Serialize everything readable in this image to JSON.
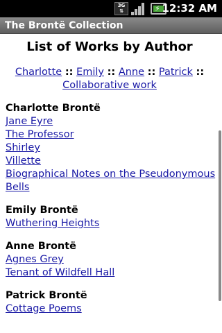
{
  "status_bar": {
    "network": "3G",
    "time": "12:32 AM"
  },
  "app": {
    "title": "The Brontë Collection"
  },
  "page": {
    "title": "List of Works by Author",
    "nav": {
      "charlotte": "Charlotte",
      "emily": "Emily",
      "anne": "Anne",
      "patrick": "Patrick",
      "collaborative": "Collaborative work",
      "separator": "::"
    },
    "sections": [
      {
        "author": "Charlotte Brontë",
        "works": [
          "Jane Eyre ",
          "The Professor ",
          "Shirley",
          "Villette",
          "Biographical Notes on the Pseudonymous Bells"
        ]
      },
      {
        "author": "Emily Brontë",
        "works": [
          "Wuthering Heights"
        ]
      },
      {
        "author": "Anne Brontë",
        "works": [
          "Agnes Grey",
          "Tenant of Wildfell Hall"
        ]
      },
      {
        "author": "Patrick Brontë",
        "works": [
          "Cottage Poems"
        ]
      }
    ]
  }
}
